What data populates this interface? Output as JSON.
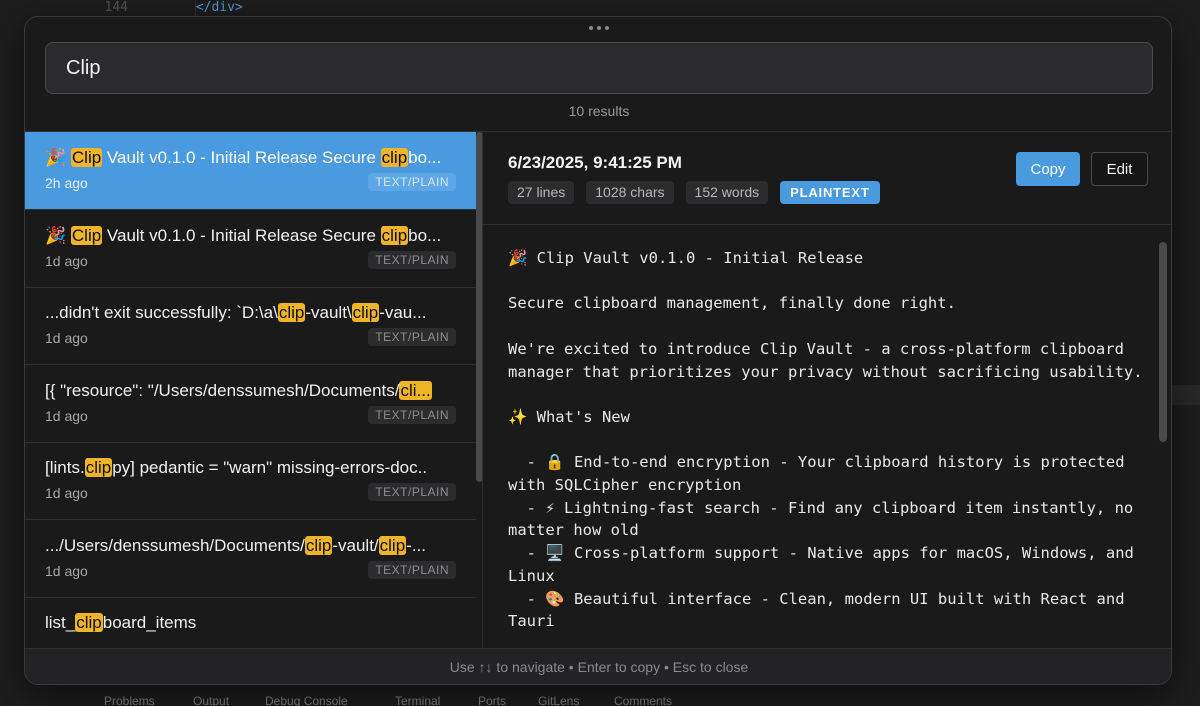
{
  "background": {
    "line_number": "144",
    "line_code": "</div>",
    "panel_tabs": [
      "Problems",
      "Output",
      "Debug Console",
      "Terminal",
      "Ports",
      "GitLens",
      "Comments"
    ]
  },
  "search": {
    "query": "Clip",
    "result_count": "10 results"
  },
  "results": [
    {
      "prefix": "🎉 ",
      "parts": [
        [
          "Clip",
          true
        ],
        [
          " Vault v0.1.0 - Initial Release Secure ",
          false
        ],
        [
          "clip",
          true
        ],
        [
          "bo...",
          false
        ]
      ],
      "time": "2h ago",
      "type": "TEXT/PLAIN",
      "selected": true
    },
    {
      "prefix": "🎉 ",
      "parts": [
        [
          "Clip",
          true
        ],
        [
          " Vault v0.1.0 - Initial Release Secure ",
          false
        ],
        [
          "clip",
          true
        ],
        [
          "bo...",
          false
        ]
      ],
      "time": "1d ago",
      "type": "TEXT/PLAIN",
      "selected": false
    },
    {
      "prefix": "",
      "parts": [
        [
          "...didn't exit successfully: `D:\\a\\",
          false
        ],
        [
          "clip",
          true
        ],
        [
          "-vault\\",
          false
        ],
        [
          "clip",
          true
        ],
        [
          "-vau...",
          false
        ]
      ],
      "time": "1d ago",
      "type": "TEXT/PLAIN",
      "selected": false
    },
    {
      "prefix": "",
      "parts": [
        [
          "[{ \"resource\": \"/Users/denssumesh/Documents/",
          false
        ],
        [
          "cli...",
          true
        ]
      ],
      "time": "1d ago",
      "type": "TEXT/PLAIN",
      "selected": false
    },
    {
      "prefix": "",
      "parts": [
        [
          "[lints.",
          false
        ],
        [
          "clip",
          true
        ],
        [
          "py] pedantic = \"warn\" missing-errors-doc..",
          false
        ]
      ],
      "time": "1d ago",
      "type": "TEXT/PLAIN",
      "selected": false
    },
    {
      "prefix": "",
      "parts": [
        [
          ".../Users/denssumesh/Documents/",
          false
        ],
        [
          "clip",
          true
        ],
        [
          "-vault/",
          false
        ],
        [
          "clip",
          true
        ],
        [
          "-...",
          false
        ]
      ],
      "time": "1d ago",
      "type": "TEXT/PLAIN",
      "selected": false
    },
    {
      "prefix": "",
      "parts": [
        [
          "list_",
          false
        ],
        [
          "clip",
          true
        ],
        [
          "board_items",
          false
        ]
      ],
      "time": "",
      "type": "",
      "selected": false
    }
  ],
  "detail": {
    "date": "6/23/2025, 9:41:25 PM",
    "lines": "27 lines",
    "chars": "1028 chars",
    "words": "152 words",
    "language": "PLAINTEXT",
    "copy_label": "Copy",
    "edit_label": "Edit",
    "content": "🎉 Clip Vault v0.1.0 - Initial Release\n\nSecure clipboard management, finally done right.\n\nWe're excited to introduce Clip Vault - a cross-platform clipboard manager that prioritizes your privacy without sacrificing usability.\n\n✨ What's New\n\n  - 🔒 End-to-end encryption - Your clipboard history is protected with SQLCipher encryption\n  - ⚡ Lightning-fast search - Find any clipboard item instantly, no matter how old\n  - 🖥️ Cross-platform support - Native apps for macOS, Windows, and Linux\n  - 🎨 Beautiful interface - Clean, modern UI built with React and Tauri"
  },
  "footer": {
    "hint": "Use ↑↓ to navigate • Enter to copy • Esc to close"
  },
  "colors": {
    "accent": "#4a9ae0",
    "highlight": "#f0b429"
  }
}
